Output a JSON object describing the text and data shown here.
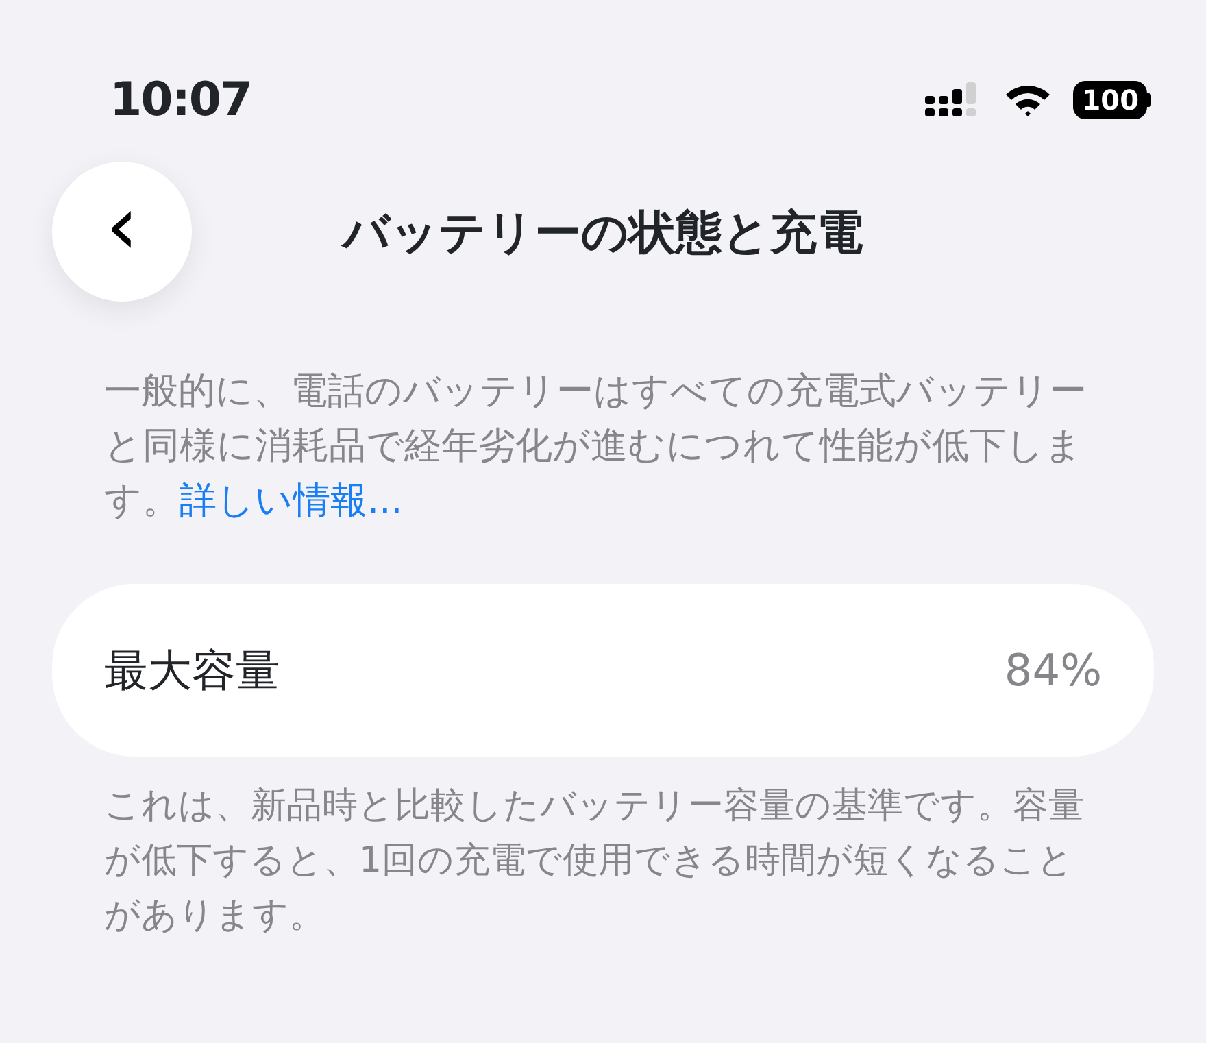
{
  "status_bar": {
    "time": "10:07",
    "battery": "100"
  },
  "nav": {
    "back": "‹",
    "title": "バッテリーの状態と充電"
  },
  "intro": {
    "text": "一般的に、電話のバッテリーはすべての充電式バッテリーと同様に消耗品で経年劣化が進むにつれて性能が低下します。",
    "link": "詳しい情報..."
  },
  "capacity": {
    "label": "最大容量",
    "value": "84%"
  },
  "note": "これは、新品時と比較したバッテリー容量の基準です。容量が低下すると、1回の充電で使用できる時間が短くなることがあります。"
}
